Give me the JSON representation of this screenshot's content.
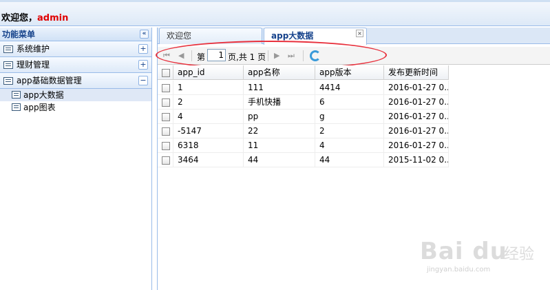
{
  "header": {
    "welcome": "欢迎您，",
    "user": "admin"
  },
  "menu": {
    "title": "功能菜单",
    "collapse_glyph": "«",
    "groups": [
      {
        "label": "系统维护",
        "toggle": "+"
      },
      {
        "label": "理财管理",
        "toggle": "+"
      },
      {
        "label": "app基础数据管理",
        "toggle": "−"
      }
    ],
    "items": [
      {
        "label": "app大数据"
      },
      {
        "label": "app图表"
      }
    ]
  },
  "tabs": [
    {
      "label": "欢迎您"
    },
    {
      "label": "app大数据",
      "close": "×"
    }
  ],
  "pager": {
    "first": "⏮",
    "prev": "◀",
    "next": "▶",
    "last": "⏭",
    "page_prefix": "第",
    "page_value": "1",
    "page_suffix": "页,共 1 页"
  },
  "grid": {
    "columns": [
      "app_id",
      "app名称",
      "app版本",
      "发布更新时间"
    ],
    "rows": [
      [
        "1",
        "111",
        "4414",
        "2016-01-27 0..."
      ],
      [
        "2",
        "手机快播",
        "6",
        "2016-01-27 0..."
      ],
      [
        "4",
        "pp",
        "g",
        "2016-01-27 0..."
      ],
      [
        "-5147",
        "22",
        "2",
        "2016-01-27 0..."
      ],
      [
        "6318",
        "11",
        "4",
        "2016-01-27 0..."
      ],
      [
        "3464",
        "44",
        "44",
        "2015-11-02 0..."
      ]
    ]
  },
  "watermark": {
    "logo": "Bai du",
    "text": "经验",
    "url": "jingyan.baidu.com"
  }
}
